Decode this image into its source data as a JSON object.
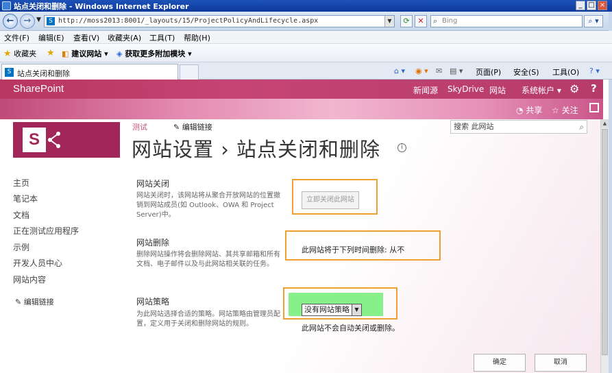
{
  "window": {
    "title": "站点关闭和删除 - Windows Internet Explorer"
  },
  "address": {
    "url": "http://moss2013:8001/_layouts/15/ProjectPolicyAndLifecycle.aspx",
    "search_placeholder": "Bing"
  },
  "menu": [
    "文件(F)",
    "编辑(E)",
    "查看(V)",
    "收藏夹(A)",
    "工具(T)",
    "帮助(H)"
  ],
  "favorites": {
    "label": "收藏夹",
    "suggested": "建议网站",
    "addons": "获取更多附加模块"
  },
  "tab": {
    "title": "站点关闭和删除"
  },
  "commandbar": {
    "page": "页面(P)",
    "safety": "安全(S)",
    "tools": "工具(O)"
  },
  "suitebar": {
    "brand": "SharePoint",
    "links": [
      "新闻源",
      "SkyDrive",
      "网站"
    ],
    "account": "系统帐户"
  },
  "ribbon": {
    "share": "共享",
    "follow": "关注"
  },
  "header": {
    "crumb": "测试",
    "edit_links": "编辑链接",
    "title": "网站设置 › 站点关闭和删除",
    "search_placeholder": "搜索 此网站"
  },
  "leftnav": {
    "items": [
      "主页",
      "笔记本",
      "文档",
      "正在测试应用程序",
      "示例",
      "开发人员中心",
      "网站内容"
    ],
    "edit_links": "编辑链接"
  },
  "sections": {
    "close": {
      "heading": "网站关闭",
      "desc": "网站关闭时，该网站将从聚合开放网站的位置撤销到网站成员(如 Outlook、OWA 和 Project Server)中。",
      "button": "立即关闭此网站"
    },
    "delete": {
      "heading": "网站删除",
      "desc": "删除网站操作将会删除网站、其共享邮箱和所有文档、电子邮件以及与此网站相关联的任务。",
      "status": "此网站将于下列时间删除: 从不"
    },
    "policy": {
      "heading": "网站策略",
      "desc": "为此网站选择合适的策略。网站策略由管理员配置，定义用于关闭和删除网站的规则。",
      "selected": "没有网站策略",
      "note": "此网站不会自动关闭或删除。"
    }
  },
  "buttons": {
    "ok": "确定",
    "cancel": "取消"
  },
  "colors": {
    "brand": "#a3265a",
    "highlight": "#f0a030",
    "policy_bg": "#88f088"
  }
}
